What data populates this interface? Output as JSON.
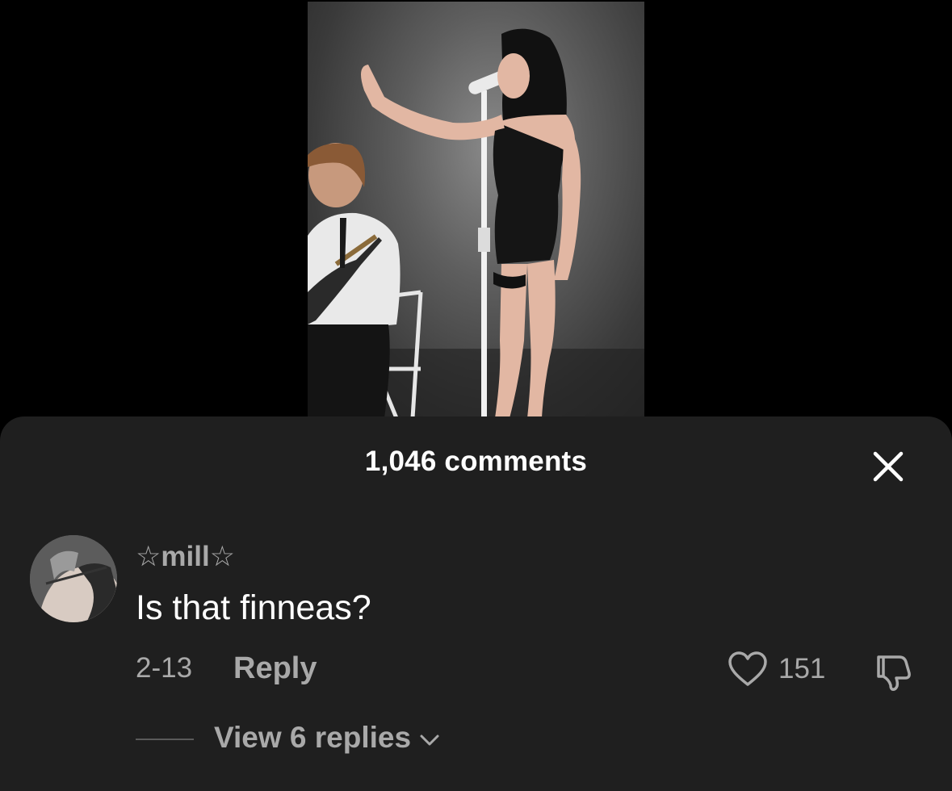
{
  "video": {
    "description_icon": "video-frame"
  },
  "sheet": {
    "title": "1,046 comments",
    "close_icon": "close-icon"
  },
  "comment": {
    "username": "☆mill☆",
    "text": "Is that finneas?",
    "date": "2-13",
    "reply_label": "Reply",
    "like_count": "151",
    "view_replies_label": "View 6 replies"
  },
  "colors": {
    "sheet_bg": "#1f1f1f",
    "primary_text": "#ffffff",
    "secondary_text": "#a9a9a9",
    "background": "#000000"
  }
}
